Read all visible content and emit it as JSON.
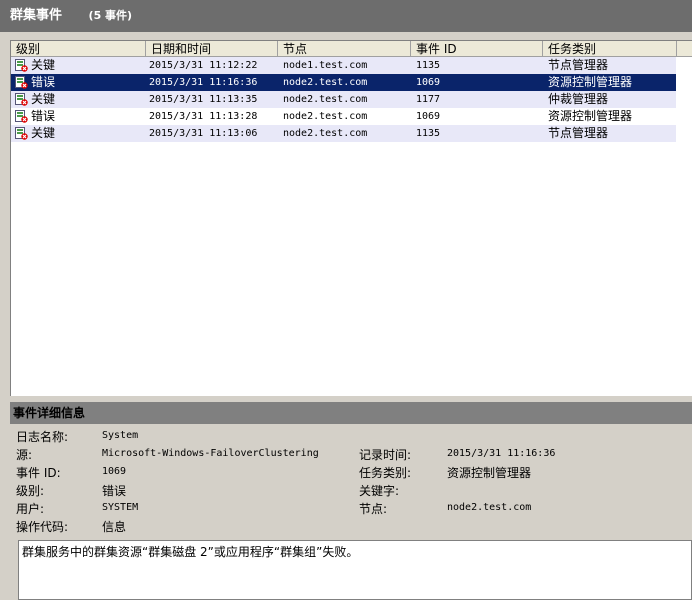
{
  "title": "群集事件",
  "event_count": "(5 事件)",
  "columns": [
    "级别",
    "日期和时间",
    "节点",
    "事件 ID",
    "任务类别"
  ],
  "events": [
    {
      "level": "关键",
      "datetime": "2015/3/31 11:12:22",
      "node": "node1.test.com",
      "event_id": "1135",
      "category": "节点管理器"
    },
    {
      "level": "错误",
      "datetime": "2015/3/31 11:16:36",
      "node": "node2.test.com",
      "event_id": "1069",
      "category": "资源控制管理器"
    },
    {
      "level": "关键",
      "datetime": "2015/3/31 11:13:35",
      "node": "node2.test.com",
      "event_id": "1177",
      "category": "仲裁管理器"
    },
    {
      "level": "错误",
      "datetime": "2015/3/31 11:13:28",
      "node": "node2.test.com",
      "event_id": "1069",
      "category": "资源控制管理器"
    },
    {
      "level": "关键",
      "datetime": "2015/3/31 11:13:06",
      "node": "node2.test.com",
      "event_id": "1135",
      "category": "节点管理器"
    }
  ],
  "details": {
    "header": "事件详细信息",
    "log_name_label": "日志名称:",
    "log_name": "System",
    "source_label": "源:",
    "source": "Microsoft-Windows-FailoverClustering",
    "event_id_label": "事件 ID:",
    "event_id": "1069",
    "level_label": "级别:",
    "level": "错误",
    "user_label": "用户:",
    "user": "SYSTEM",
    "opcode_label": "操作代码:",
    "opcode": "信息",
    "logged_label": "记录时间:",
    "logged": "2015/3/31 11:16:36",
    "category_label": "任务类别:",
    "category": "资源控制管理器",
    "keywords_label": "关键字:",
    "keywords": "",
    "node_label": "节点:",
    "node": "node2.test.com",
    "message": "群集服务中的群集资源“群集磁盘 2”或应用程序“群集组”失败。"
  },
  "colors": {
    "selected": "#0a246a",
    "alt_row": "#e8e8f8",
    "title_bar": "#6d6d6d"
  }
}
